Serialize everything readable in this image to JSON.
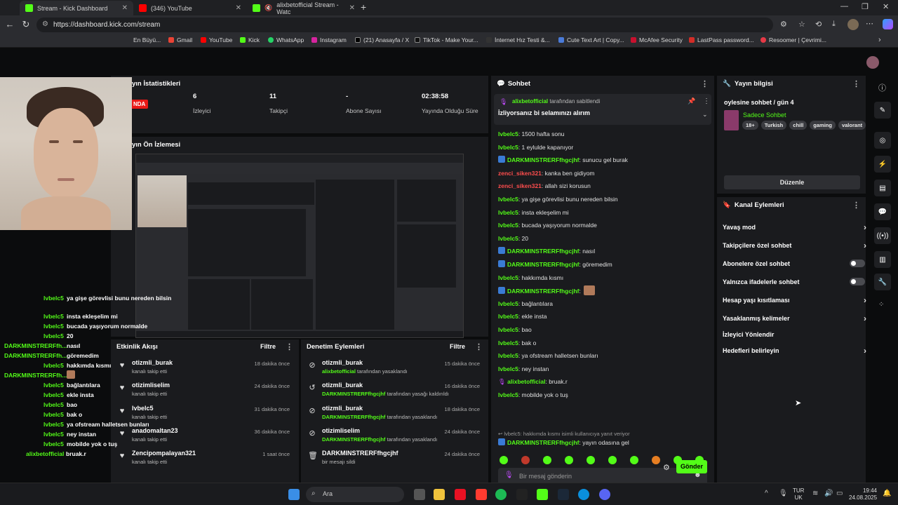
{
  "browser": {
    "tabs": [
      {
        "title": "Stream - Kick Dashboard",
        "color": "#53fc18"
      },
      {
        "title": "(346) YouTube",
        "color": "#ff0000"
      },
      {
        "title": "alixbetofficial Stream - Watc",
        "color": "#53fc18"
      }
    ],
    "url": "https://dashboard.kick.com/stream",
    "bookmarks": [
      "En Büyü...",
      "Gmail",
      "YouTube",
      "Kick",
      "WhatsApp",
      "Instagram",
      "(21) Anasayfa / X",
      "TikTok - Make Your...",
      "İnternet Hız Testi &...",
      "Cute Text Art | Copy...",
      "McAfee Security",
      "LastPass password...",
      "Resoomer | Çevrimi..."
    ]
  },
  "stats": {
    "title": "yın İstatistikleri",
    "live_badge": "NDA",
    "cells": [
      {
        "value": "6",
        "label": "İzleyici"
      },
      {
        "value": "11",
        "label": "Takipçi"
      },
      {
        "value": "-",
        "label": "Abone Sayısı"
      },
      {
        "value": "02:38:58",
        "label": "Yayında Olduğu Süre"
      }
    ]
  },
  "preview": {
    "title": "yın Ön İzlemesi"
  },
  "activity": {
    "title": "Etkinlik Akışı",
    "filter": "Filtre",
    "items": [
      {
        "name": "otizmli_burak",
        "sub": "kanalı takip etti",
        "time": "18 dakika önce"
      },
      {
        "name": "otizimliselim",
        "sub": "kanalı takip etti",
        "time": "24 dakika önce"
      },
      {
        "name": "lvbelc5",
        "sub": "kanalı takip etti",
        "time": "31 dakika önce"
      },
      {
        "name": "anadomaltan23",
        "sub": "kanalı takip etti",
        "time": "36 dakika önce"
      },
      {
        "name": "Zencipompalayan321",
        "sub": "kanalı takip etti",
        "time": "1 saat önce"
      }
    ]
  },
  "moderation": {
    "title": "Denetim Eylemleri",
    "filter": "Filtre",
    "items": [
      {
        "name": "otizmli_burak",
        "actor": "alixbetofficial",
        "action": " tarafından yasaklandı",
        "time": "15 dakika önce",
        "icon": "ban"
      },
      {
        "name": "otizmli_burak",
        "actor": "DARKMINSTRERFfhgcjhf",
        "action": " tarafından yasağı kaldırıldı",
        "time": "16 dakika önce",
        "icon": "undo"
      },
      {
        "name": "otizmli_burak",
        "actor": "DARKMINSTRERFfhgcjhf",
        "action": " tarafından yasaklandı",
        "time": "18 dakika önce",
        "icon": "ban"
      },
      {
        "name": "otizimliselim",
        "actor": "DARKMINSTRERFfhgcjhf",
        "action": " tarafından yasaklandı",
        "time": "24 dakika önce",
        "icon": "ban"
      },
      {
        "name": "DARKMINSTRERFfhgcjhf",
        "actor": "",
        "action": "bir mesajı sildi",
        "time": "24 dakika önce",
        "icon": "trash"
      }
    ]
  },
  "chat": {
    "title": "Sohbet",
    "pinned": {
      "user": "alixbetofficial",
      "by": "tarafından sabitlendi",
      "text": "İzliyorsanız bi selamınızı alırım"
    },
    "messages": [
      {
        "user": "lvbelc5",
        "text": ": 1500 hafta sonu",
        "style": "g"
      },
      {
        "user": "lvbelc5",
        "text": ": 1 eylulde kapanıyor",
        "style": "g"
      },
      {
        "user": "DARKMINSTRERFfhgcjhf",
        "text": ": sunucu gel burak",
        "style": "g",
        "badge": true
      },
      {
        "user": "zenci_siken321",
        "text": ": kanka ben gidiyom",
        "style": "r"
      },
      {
        "user": "zenci_siken321",
        "text": ": allah sizi korusun",
        "style": "r"
      },
      {
        "user": "lvbelc5",
        "text": ": ya gişe görevlisi bunu nereden bilsin",
        "style": "g"
      },
      {
        "user": "lvbelc5",
        "text": ": insta ekleşelim mi",
        "style": "g"
      },
      {
        "user": "lvbelc5",
        "text": ": bucada yaşıyorum normalde",
        "style": "g"
      },
      {
        "user": "lvbelc5",
        "text": ": 20",
        "style": "g"
      },
      {
        "user": "DARKMINSTRERFfhgcjhf",
        "text": ": nasıl",
        "style": "g",
        "badge": true
      },
      {
        "user": "DARKMINSTRERFfhgcjhf",
        "text": ": göremedim",
        "style": "g",
        "badge": true
      },
      {
        "user": "lvbelc5",
        "text": ": hakkımda kısmı",
        "style": "g"
      },
      {
        "user": "DARKMINSTRERFfhgcjhf",
        "text": ":",
        "style": "g",
        "badge": true,
        "emote": true
      },
      {
        "user": "lvbelc5",
        "text": ": bağlantılara",
        "style": "g"
      },
      {
        "user": "lvbelc5",
        "text": ": ekle insta",
        "style": "g"
      },
      {
        "user": "lvbelc5",
        "text": ": bao",
        "style": "g"
      },
      {
        "user": "lvbelc5",
        "text": ": bak o",
        "style": "g"
      },
      {
        "user": "lvbelc5",
        "text": ": ya ofstream halletsen bunları",
        "style": "g"
      },
      {
        "user": "lvbelc5",
        "text": ": ney instan",
        "style": "g"
      },
      {
        "user": "alixbetofficial",
        "text": ": bruak.r",
        "style": "g",
        "mic": true
      },
      {
        "user": "lvbelc5",
        "text": ": mobilde yok o tuş",
        "style": "g"
      }
    ],
    "reply_hint": "lvbelc5: hakkımda kısmı isimli kullanıcıya yanıt veriyor",
    "last": {
      "user": "DARKMINSTRERFfhgcjhf",
      "text": ": yayın odasına gel"
    },
    "placeholder": "Bir mesaj gönderin",
    "send": "Gönder"
  },
  "stream_info": {
    "title": "Yayın bilgisi",
    "stream_title": "oylesine sohbet / gün 4",
    "category": "Sadece Sohbet",
    "tags": [
      "18+",
      "Turkish",
      "chill",
      "gaming",
      "valorant"
    ],
    "edit": "Düzenle"
  },
  "channel_actions": {
    "title": "Kanal Eylemleri",
    "items": [
      {
        "label": "Yavaş mod",
        "kind": "chevron"
      },
      {
        "label": "Takipçilere özel sohbet",
        "kind": "chevron"
      },
      {
        "label": "Abonelere özel sohbet",
        "kind": "toggle"
      },
      {
        "label": "Yalnızca ifadelerle sohbet",
        "kind": "toggle"
      },
      {
        "label": "Hesap yaşı kısıtlaması",
        "kind": "chevron"
      },
      {
        "label": "Yasaklanmış kelimeler",
        "kind": "chevron"
      },
      {
        "label": "İzleyici Yönlendir",
        "kind": "none"
      },
      {
        "label": "Hedefleri belirleyin",
        "kind": "chevron"
      }
    ]
  },
  "overlay_chat": [
    {
      "user": "lvbelc5",
      "text": "ya gişe görevlisi bunu nereden bilsin",
      "color": "#53fc18"
    },
    {
      "user": "lvbelc5",
      "text": "insta ekleşelim mi",
      "color": "#53fc18"
    },
    {
      "user": "lvbelc5",
      "text": "bucada yaşıyorum normalde",
      "color": "#53fc18"
    },
    {
      "user": "lvbelc5",
      "text": "20",
      "color": "#53fc18"
    },
    {
      "user": "DARKMINSTRERFfh...",
      "text": "nasıl",
      "color": "#53fc18"
    },
    {
      "user": "DARKMINSTRERFfh...",
      "text": "göremedim",
      "color": "#53fc18"
    },
    {
      "user": "lvbelc5",
      "text": "hakkımda kısmı",
      "color": "#53fc18"
    },
    {
      "user": "DARKMINSTRERFfh...",
      "text": "",
      "color": "#53fc18"
    },
    {
      "user": "lvbelc5",
      "text": "bağlantılara",
      "color": "#53fc18"
    },
    {
      "user": "lvbelc5",
      "text": "ekle insta",
      "color": "#53fc18"
    },
    {
      "user": "lvbelc5",
      "text": "bao",
      "color": "#53fc18"
    },
    {
      "user": "lvbelc5",
      "text": "bak o",
      "color": "#53fc18"
    },
    {
      "user": "lvbelc5",
      "text": "ya ofstream halletsen bunları",
      "color": "#53fc18"
    },
    {
      "user": "lvbelc5",
      "text": "ney instan",
      "color": "#53fc18"
    },
    {
      "user": "lvbelc5",
      "text": "mobilde yok o tuş",
      "color": "#53fc18"
    },
    {
      "user": "alixbetofficial",
      "text": "bruak.r",
      "color": "#53fc18"
    }
  ],
  "taskbar": {
    "search": "Ara",
    "lang1": "TUR",
    "lang2": "UK",
    "time": "19:44",
    "date": "24.08.2025"
  }
}
